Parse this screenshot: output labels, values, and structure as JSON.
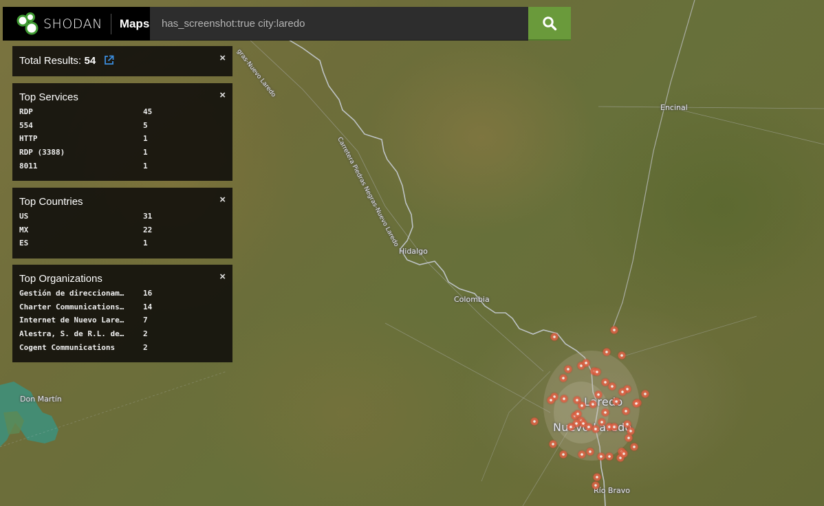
{
  "header": {
    "brand_name": "Shodan",
    "brand_product": "Maps",
    "search": {
      "value": "has_screenshot:true city:laredo",
      "placeholder": "",
      "button_icon": "search-icon"
    }
  },
  "total": {
    "label": "Total Results:",
    "count": "54",
    "link_icon": "external-link-icon",
    "close_label": "×"
  },
  "panels": {
    "services": {
      "title": "Top Services",
      "close_label": "×",
      "rows": [
        {
          "key": "RDP",
          "value": "45"
        },
        {
          "key": "554",
          "value": "5"
        },
        {
          "key": "HTTP",
          "value": "1"
        },
        {
          "key": "RDP (3388)",
          "value": "1"
        },
        {
          "key": "8011",
          "value": "1"
        }
      ]
    },
    "countries": {
      "title": "Top Countries",
      "close_label": "×",
      "rows": [
        {
          "key": "US",
          "value": "31"
        },
        {
          "key": "MX",
          "value": "22"
        },
        {
          "key": "ES",
          "value": "1"
        }
      ]
    },
    "organizations": {
      "title": "Top Organizations",
      "close_label": "×",
      "rows": [
        {
          "key": "Gestión de direccionam…",
          "value": "16"
        },
        {
          "key": "Charter Communications…",
          "value": "14"
        },
        {
          "key": "Internet de Nuevo Lare…",
          "value": "7"
        },
        {
          "key": "Alestra, S. de R.L. de…",
          "value": "2"
        },
        {
          "key": "Cogent Communications",
          "value": "2"
        }
      ]
    }
  },
  "map": {
    "labels": {
      "encinal": "Encinal",
      "hidalgo": "Hidalgo",
      "colombia": "Colombia",
      "laredo": "Laredo",
      "nuevo_laredo": "Nuevo Laredo",
      "rio_bravo": "Río Bravo",
      "don_martin": "Don Martín",
      "highway_upper": "gras-Nuevo Laredo",
      "highway_lower": "Carretera Piedras Negras-Nuevo Laredo"
    },
    "marker_color": "#d9553a",
    "result_marker_count": 54
  }
}
